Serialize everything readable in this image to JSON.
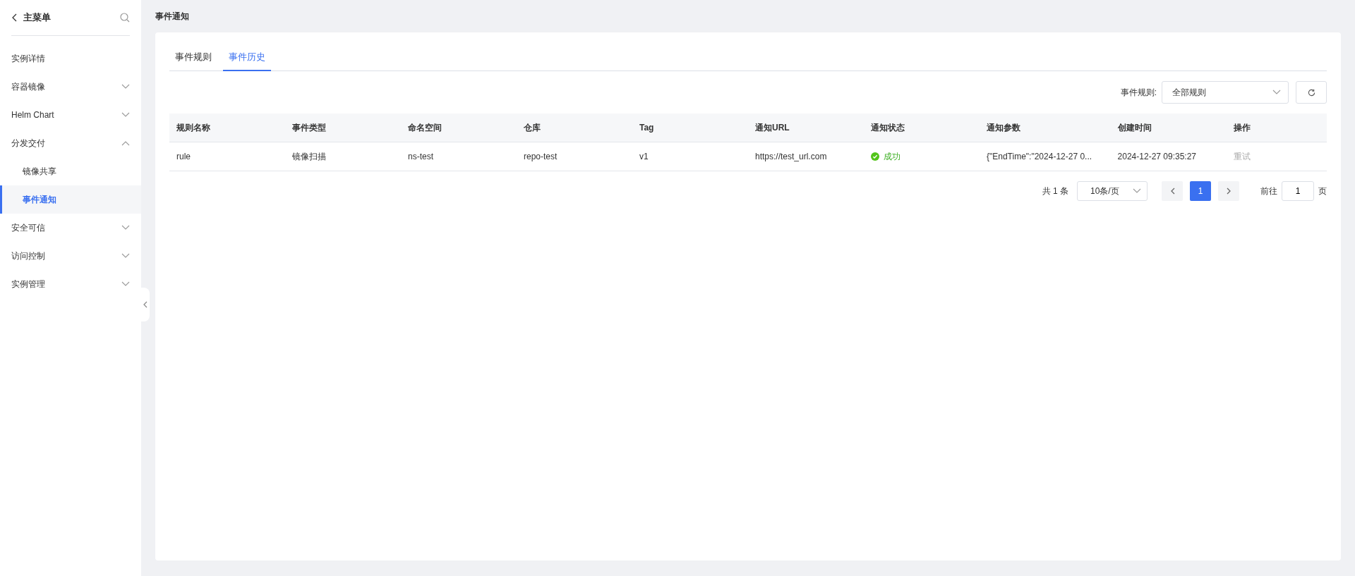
{
  "sidebar": {
    "title": "主菜单",
    "items": [
      {
        "label": "实例详情",
        "selected": false
      },
      {
        "label": "容器镜像",
        "selected": false,
        "expanded": false
      },
      {
        "label": "Helm Chart",
        "selected": false,
        "expanded": false
      },
      {
        "label": "分发交付",
        "selected": false,
        "expanded": true,
        "children": [
          {
            "label": "镜像共享",
            "selected": false
          },
          {
            "label": "事件通知",
            "selected": true
          }
        ]
      },
      {
        "label": "安全可信",
        "selected": false,
        "expanded": false
      },
      {
        "label": "访问控制",
        "selected": false,
        "expanded": false
      },
      {
        "label": "实例管理",
        "selected": false,
        "expanded": false
      }
    ]
  },
  "page_title": "事件通知",
  "tabs": [
    {
      "label": "事件规则",
      "selected": false
    },
    {
      "label": "事件历史",
      "selected": true
    }
  ],
  "filter": {
    "label": "事件规则:",
    "value": "全部规则"
  },
  "table": {
    "columns": [
      "规则名称",
      "事件类型",
      "命名空间",
      "仓库",
      "Tag",
      "通知URL",
      "通知状态",
      "通知参数",
      "创建时间",
      "操作"
    ],
    "rows": [
      {
        "cells": [
          "rule",
          "镜像扫描",
          "ns-test",
          "repo-test",
          "v1",
          "https://test_url.com"
        ],
        "status": {
          "text": "成功",
          "kind": "success"
        },
        "params": "{\"EndTime\":\"2024-12-27 0...",
        "created": "2024-12-27 09:35:27",
        "action": {
          "label": "重试",
          "disabled": true
        }
      }
    ]
  },
  "pagination": {
    "total": "共 1 条",
    "page_size": "10条/页",
    "pages": [
      {
        "label": "1",
        "selected": true
      }
    ],
    "goto_label": "前往",
    "goto_value": "1",
    "goto_suffix": "页"
  }
}
